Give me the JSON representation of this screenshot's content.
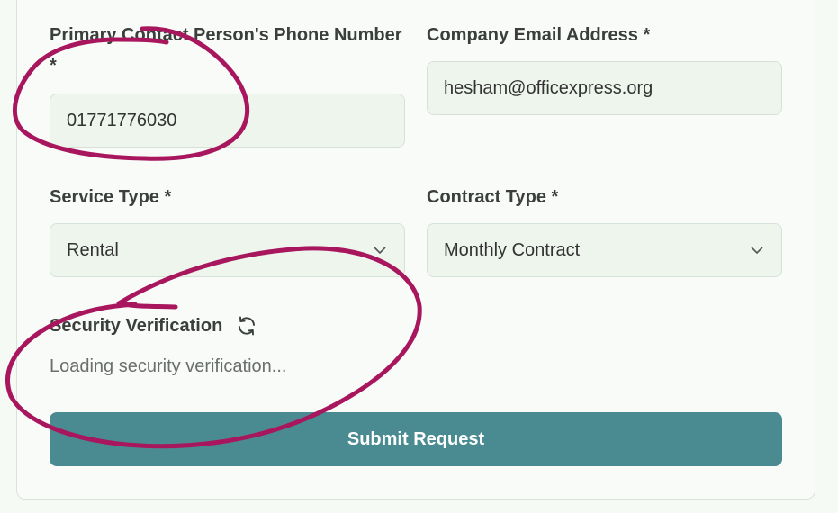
{
  "form": {
    "phone": {
      "label": "Primary Contact Person's Phone Number",
      "required": "*",
      "value": "01771776030"
    },
    "email": {
      "label": "Company Email Address *",
      "value": "hesham@officexpress.org"
    },
    "service_type": {
      "label": "Service Type *",
      "value": "Rental"
    },
    "contract_type": {
      "label": "Contract Type *",
      "value": "Monthly Contract"
    },
    "security": {
      "label": "Security Verification",
      "refresh_icon": "refresh-icon",
      "status": "Loading security verification..."
    },
    "submit_label": "Submit Request"
  },
  "colors": {
    "accent": "#4a8b92",
    "annotation": "#a8175e",
    "input_bg": "#edf5ed"
  }
}
